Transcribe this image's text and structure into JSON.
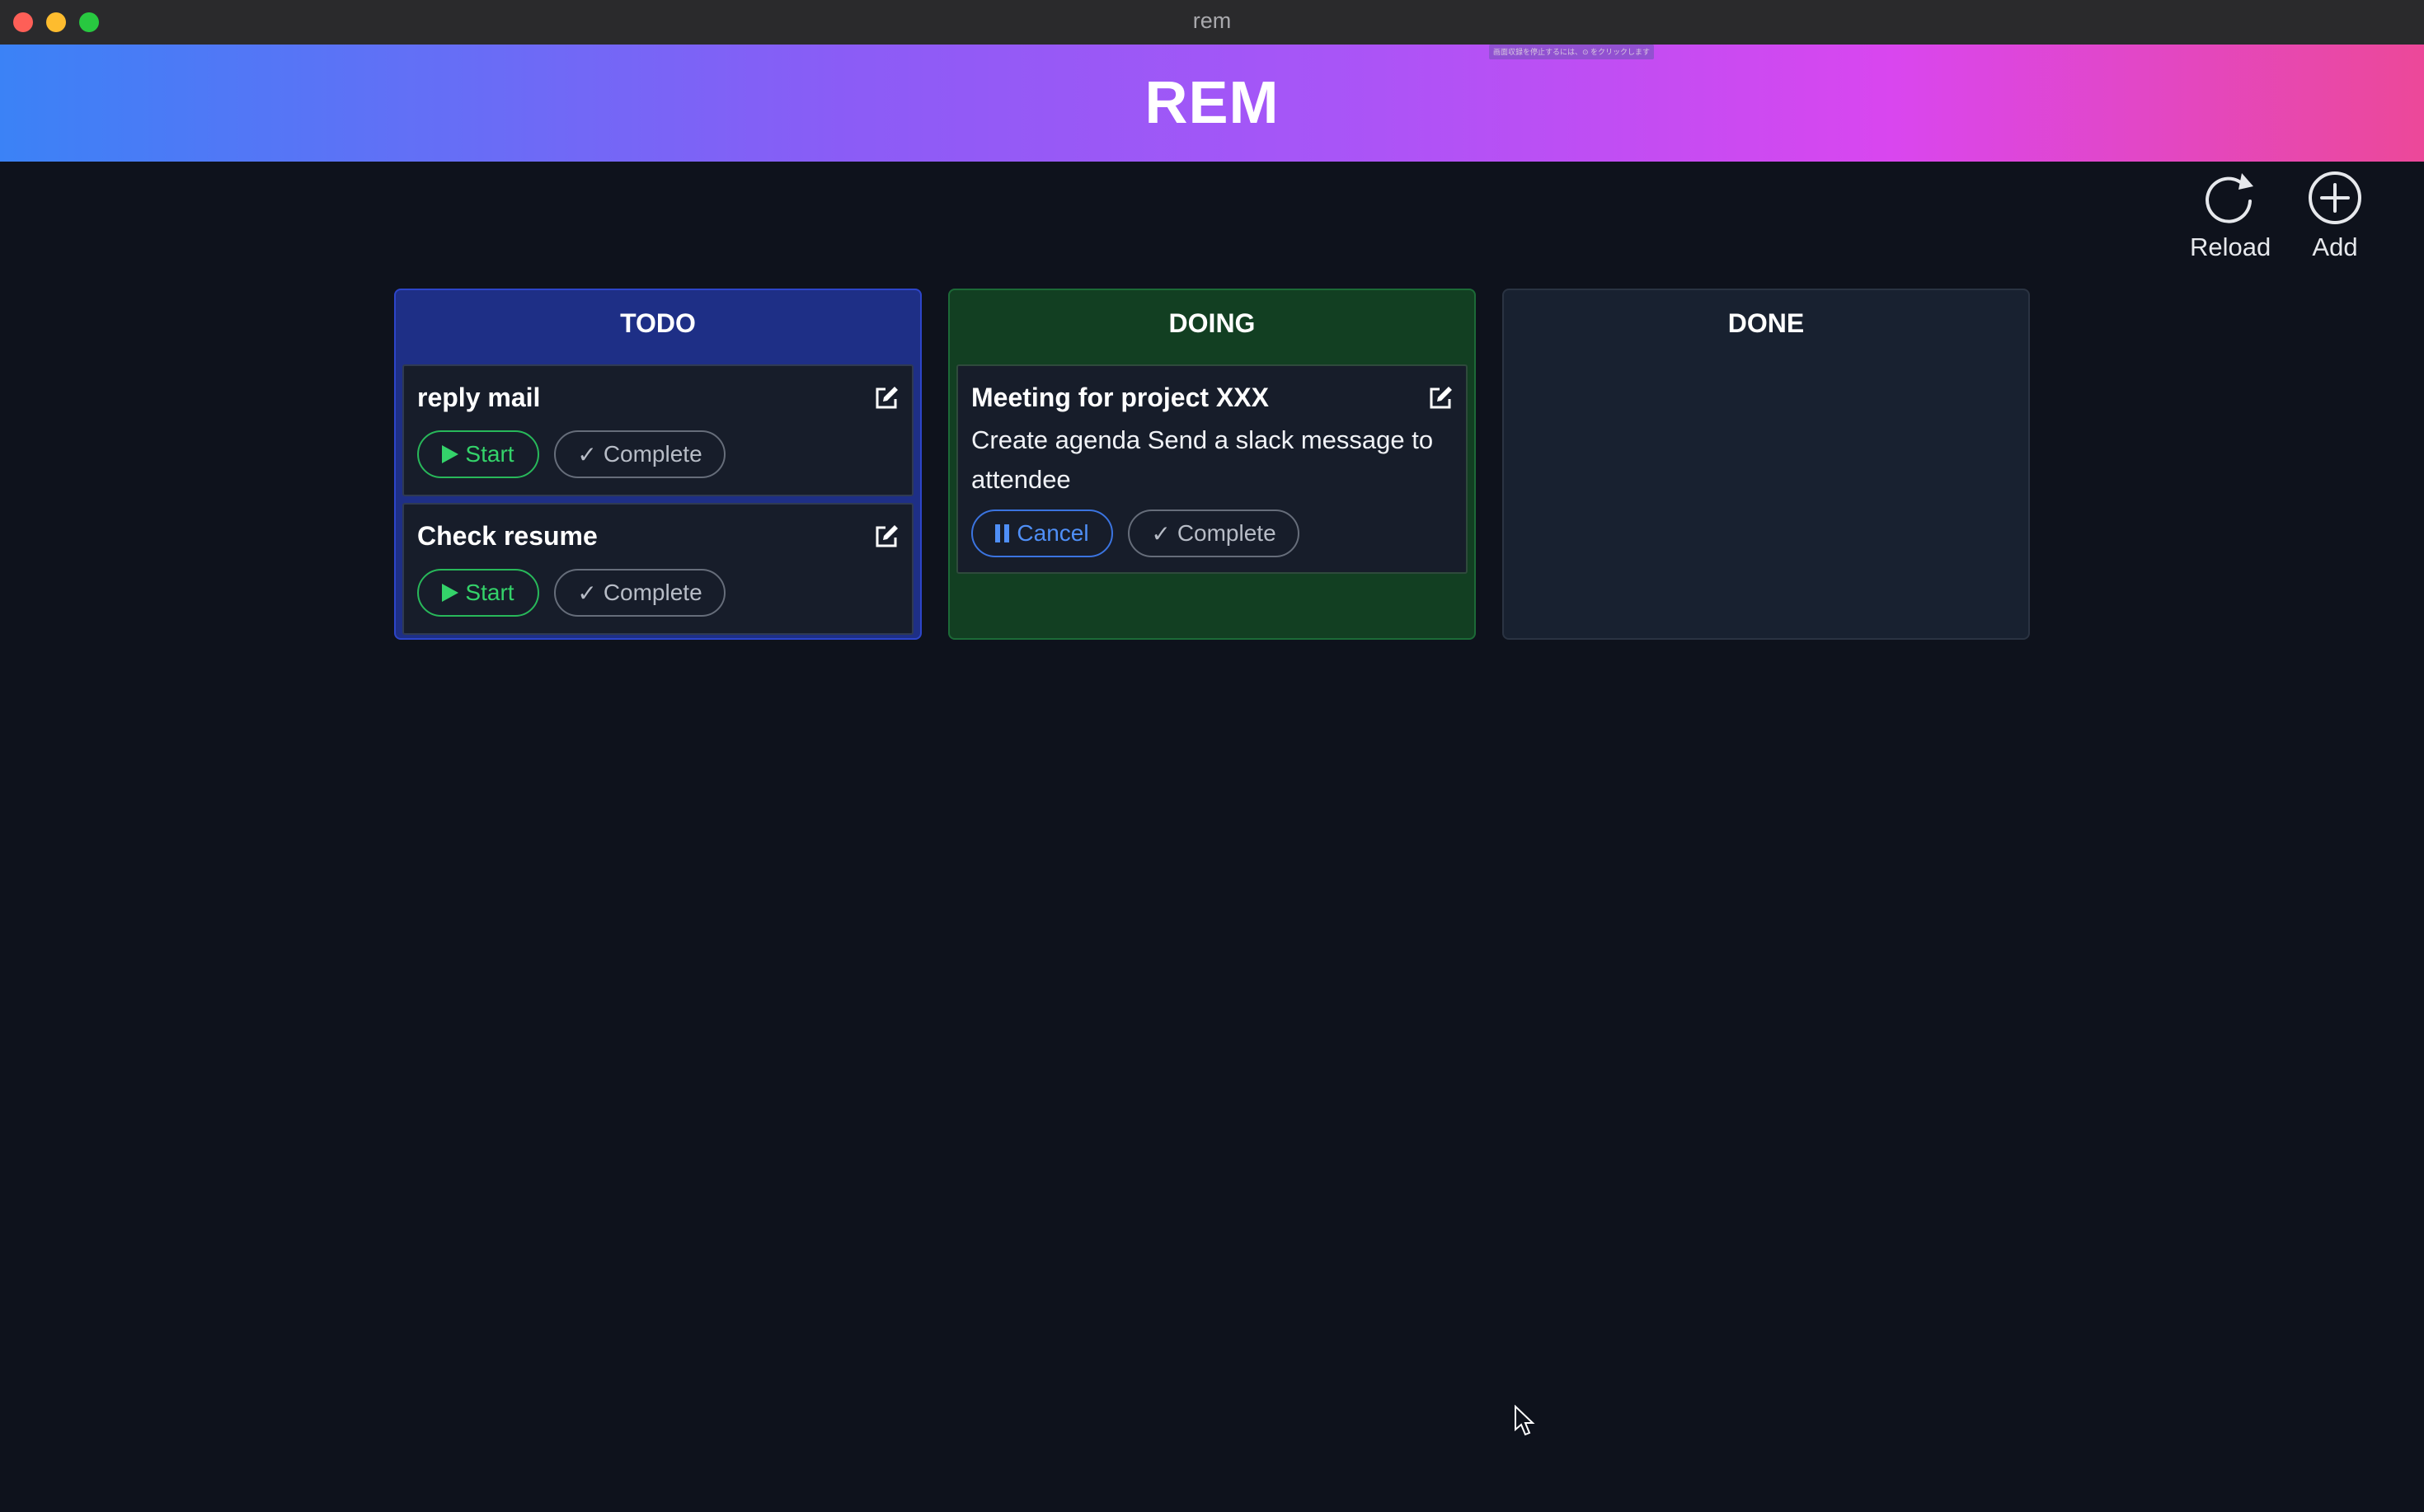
{
  "window": {
    "title": "rem"
  },
  "overlay_note": "画面収録を停止するには、⊙ をクリックします",
  "header": {
    "brand": "REM"
  },
  "toolbar": {
    "reload_label": "Reload",
    "add_label": "Add"
  },
  "columns": [
    {
      "title": "TODO",
      "cards": [
        {
          "title": "reply mail",
          "description": "",
          "primary_label": "Start",
          "secondary_label": "Complete"
        },
        {
          "title": "Check resume",
          "description": "",
          "primary_label": "Start",
          "secondary_label": "Complete"
        }
      ]
    },
    {
      "title": "DOING",
      "cards": [
        {
          "title": "Meeting for project XXX",
          "description": "Create agenda Send a slack message to attendee",
          "primary_label": "Cancel",
          "secondary_label": "Complete"
        }
      ]
    },
    {
      "title": "DONE",
      "cards": []
    }
  ],
  "colors": {
    "todo_bg": "#1e2f86",
    "doing_bg": "#123f22",
    "done_bg": "#182130",
    "start_green": "#34d36a",
    "cancel_blue": "#4f8ff7",
    "header_gradient": [
      "#3b82f6",
      "#a855f7",
      "#ec4899"
    ]
  },
  "icons": {
    "reload": "reload-icon",
    "add": "add-circle-icon",
    "edit": "edit-icon",
    "start": "play-icon",
    "complete": "check-icon",
    "cancel": "pause-icon"
  }
}
